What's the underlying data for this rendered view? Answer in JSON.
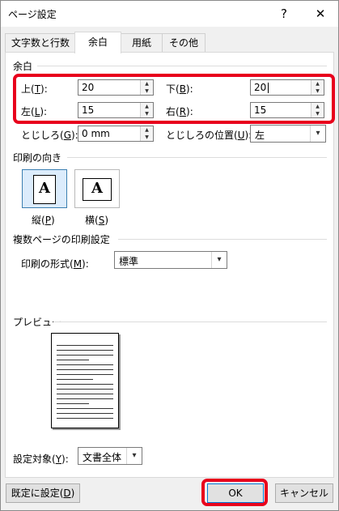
{
  "window": {
    "title": "ページ設定",
    "help_glyph": "?",
    "close_glyph": "✕"
  },
  "tabs": [
    {
      "label": "文字数と行数",
      "active": false
    },
    {
      "label": "余白",
      "active": true
    },
    {
      "label": "用紙",
      "active": false
    },
    {
      "label": "その他",
      "active": false
    }
  ],
  "margins": {
    "group_label": "余白",
    "top_label": "上(",
    "top_key": "T",
    "top_suffix": "):",
    "top_value": "20",
    "bottom_label": "下(",
    "bottom_key": "B",
    "bottom_suffix": "):",
    "bottom_value": "20",
    "left_label": "左(",
    "left_key": "L",
    "left_suffix": "):",
    "left_value": "15",
    "right_label": "右(",
    "right_key": "R",
    "right_suffix": "):",
    "right_value": "15",
    "gutter_label": "とじしろ(",
    "gutter_key": "G",
    "gutter_suffix": "):",
    "gutter_value": "0 mm",
    "gutter_pos_label": "とじしろの位置(",
    "gutter_pos_key": "U",
    "gutter_pos_suffix": "):",
    "gutter_pos_value": "左"
  },
  "orientation": {
    "group_label": "印刷の向き",
    "portrait_label": "縦(",
    "portrait_key": "P",
    "portrait_suffix": ")",
    "landscape_label": "横(",
    "landscape_key": "S",
    "landscape_suffix": ")",
    "icon_glyph": "A",
    "selected": "portrait"
  },
  "pages": {
    "group_label": "複数ページの印刷設定",
    "format_label": "印刷の形式(",
    "format_key": "M",
    "format_suffix": "):",
    "format_value": "標準"
  },
  "preview": {
    "group_label": "プレビュー"
  },
  "apply": {
    "label": "設定対象(",
    "key": "Y",
    "suffix": "):",
    "value": "文書全体"
  },
  "buttons": {
    "default_label": "既定に設定(",
    "default_key": "D",
    "default_suffix": ")",
    "ok": "OK",
    "cancel": "キャンセル"
  },
  "colors": {
    "highlight": "#e8001c",
    "selected_bg": "#dcecfc"
  }
}
